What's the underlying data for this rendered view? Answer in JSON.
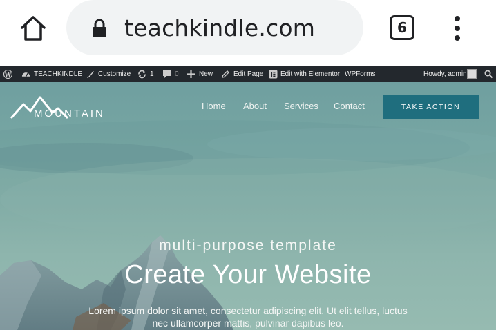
{
  "browser": {
    "url": "teachkindle.com",
    "tab_count": "6"
  },
  "admin_bar": {
    "site_name": "TEACHKINDLE",
    "customize": "Customize",
    "updates_count": "1",
    "comments_count": "0",
    "new_label": "New",
    "edit_page": "Edit Page",
    "elementor": "Edit with Elementor",
    "wpforms": "WPForms",
    "greeting": "Howdy, admin"
  },
  "site": {
    "brand": "MOUNTAIN",
    "nav": [
      "Home",
      "About",
      "Services",
      "Contact"
    ],
    "cta": "TAKE ACTION"
  },
  "hero": {
    "subtitle": "multi-purpose template",
    "title": "Create Your Website",
    "description_line1": "Lorem ipsum dolor sit amet, consectetur adipiscing elit. Ut elit tellus, luctus",
    "description_line2": "nec ullamcorper mattis, pulvinar dapibus leo."
  },
  "colors": {
    "admin_bar": "#23282d",
    "cta": "#1f6e7e",
    "omnibox": "#f1f3f4"
  }
}
